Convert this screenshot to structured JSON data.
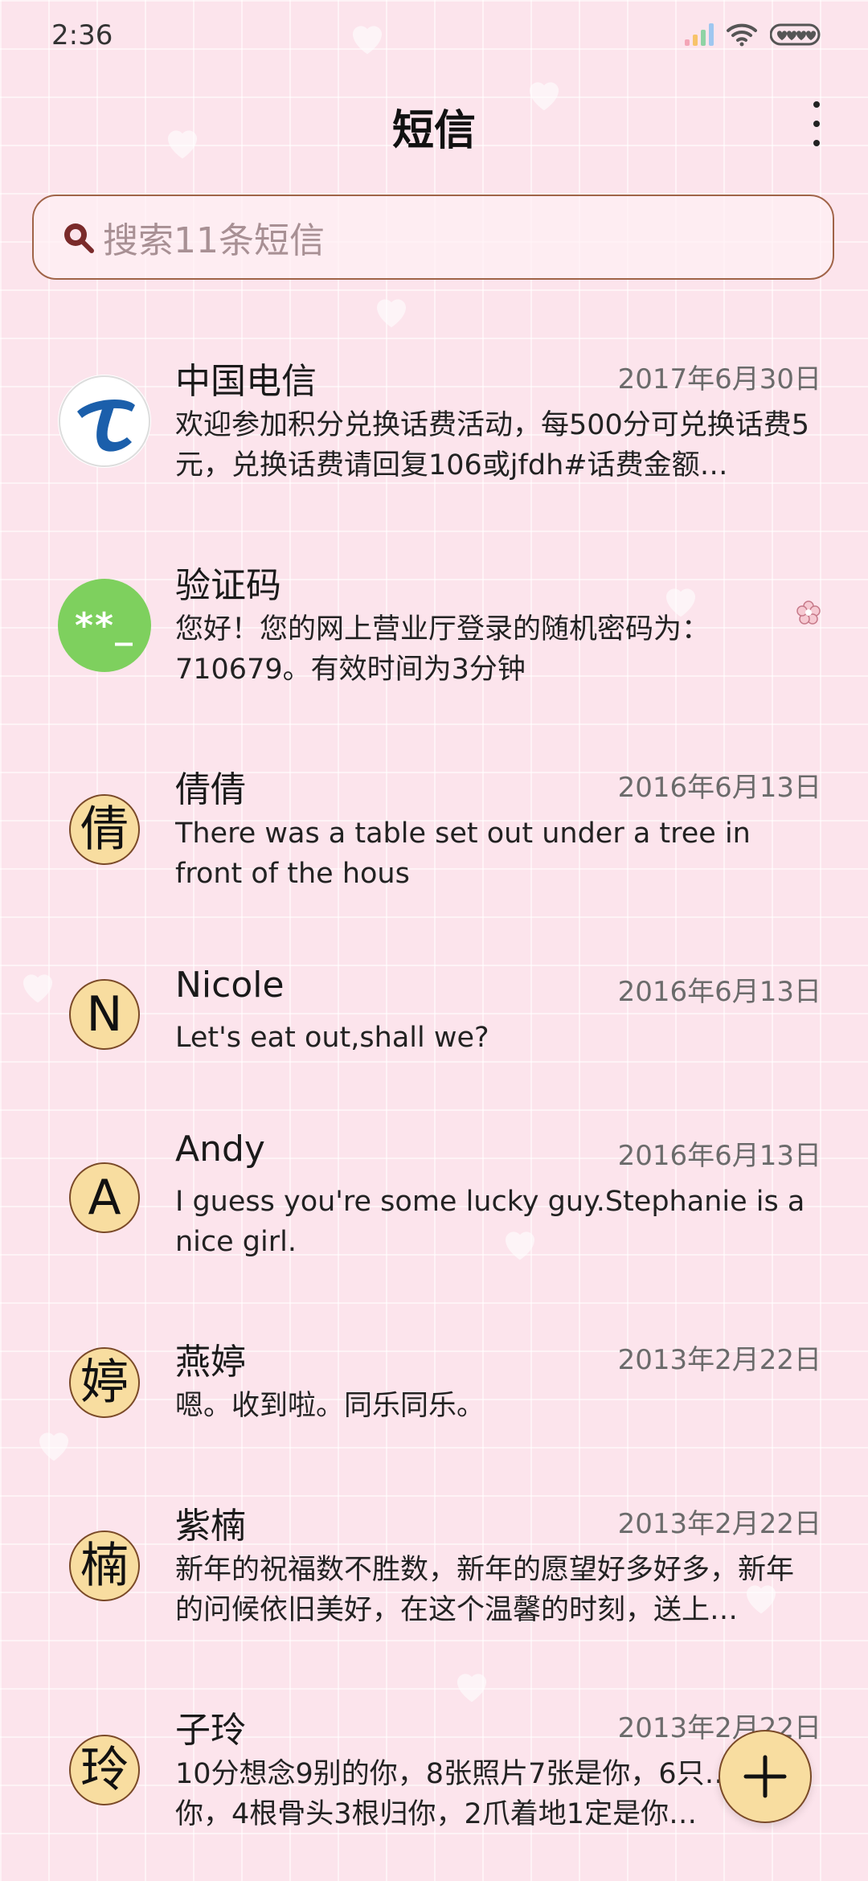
{
  "status_bar": {
    "time": "2:36"
  },
  "header": {
    "title": "短信"
  },
  "search": {
    "placeholder": "搜索11条短信"
  },
  "conversations": [
    {
      "name": "中国电信",
      "date": "2017年6月30日",
      "preview": "欢迎参加积分兑换话费活动，每500分可兑换话费5元，兑换话费请回复106或jfdh#话费金额…",
      "avatar": "china-telecom-logo"
    },
    {
      "name": "验证码",
      "date": "",
      "preview": "您好！您的网上营业厅登录的随机密码为：710679。有效时间为3分钟",
      "avatar_text": "**_",
      "avatar_color": "#7ed05e"
    },
    {
      "name": "倩倩",
      "date": "2016年6月13日",
      "preview": "There was a table set out under a tree in front of the hous",
      "avatar_text": "倩"
    },
    {
      "name": "Nicole",
      "date": "2016年6月13日",
      "preview": "Let's eat out,shall we?",
      "avatar_text": "N"
    },
    {
      "name": "Andy",
      "date": "2016年6月13日",
      "preview": "I guess you're some lucky guy.Stephanie is a nice girl.",
      "avatar_text": "A"
    },
    {
      "name": "燕婷",
      "date": "2013年2月22日",
      "preview": "嗯。收到啦。同乐同乐。",
      "avatar_text": "婷"
    },
    {
      "name": "紫楠",
      "date": "2013年2月22日",
      "preview": "新年的祝福数不胜数，新年的愿望好多好多，新年的问候依旧美好，在这个温馨的时刻，送上…",
      "avatar_text": "楠"
    },
    {
      "name": "子玲",
      "date": "2013年2月22日",
      "preview": "10分想念9别的你，8张照片7张是你，6只…只像你，4根骨头3根归你，2爪着地1定是你…",
      "avatar_text": "玲"
    }
  ],
  "colors": {
    "background": "#fce4ec",
    "avatar_fill": "#f8dda0",
    "accent_border": "#a06448",
    "telecom_blue": "#1b5fab"
  },
  "icons": {
    "search": "search-icon",
    "more": "more-vert-icon",
    "compose": "plus-icon",
    "flower": "flower-icon"
  }
}
